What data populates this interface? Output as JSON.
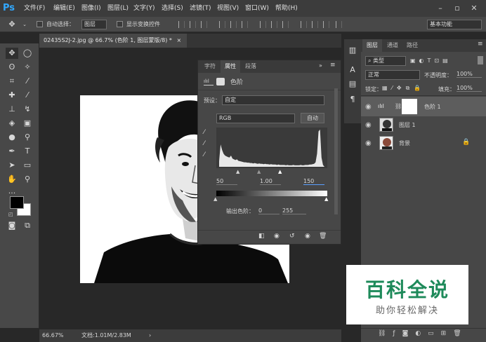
{
  "app": {
    "logo": "Ps",
    "menu": [
      "文件(F)",
      "编辑(E)",
      "图像(I)",
      "图层(L)",
      "文字(Y)",
      "选择(S)",
      "滤镜(T)",
      "视图(V)",
      "窗口(W)",
      "帮助(H)"
    ]
  },
  "options": {
    "auto_select": "自动选择：",
    "layer_select": "图层",
    "show_transform": "显示变换控件",
    "workspace": "基本功能"
  },
  "document": {
    "tab_title": "02435S2J-2.jpg @ 66.7% (色阶 1, 图层蒙版/8) *",
    "close": "×"
  },
  "status": {
    "zoom": "66.67%",
    "doc_size": "文档:1.01M/2.83M"
  },
  "properties": {
    "tabs": [
      "字符",
      "属性",
      "段落"
    ],
    "adjustment_name": "色阶",
    "preset_label": "预设：",
    "preset_value": "自定",
    "channel": "RGB",
    "auto_button": "自动",
    "input_levels": {
      "black": "50",
      "gamma": "1.00",
      "white": "150"
    },
    "output_label": "输出色阶：",
    "output_black": "0",
    "output_white": "255"
  },
  "layers_panel": {
    "tabs": [
      "图层",
      "通道",
      "路径"
    ],
    "kind_filter": "类型",
    "blend_mode": "正常",
    "opacity_label": "不透明度：",
    "opacity": "100%",
    "lock_label": "锁定：",
    "fill_label": "填充：",
    "fill": "100%",
    "layers": [
      {
        "name": "色阶 1",
        "type": "adjustment"
      },
      {
        "name": "图层 1",
        "type": "pixel"
      },
      {
        "name": "背景",
        "type": "background"
      }
    ]
  },
  "watermark": {
    "title": "百科全说",
    "subtitle": "助你轻松解决"
  },
  "histogram": [
    0.15,
    0.6,
    0.45,
    0.35,
    0.3,
    0.28,
    0.26,
    0.25,
    0.3,
    0.22,
    0.2,
    0.18,
    0.2,
    0.16,
    0.15,
    0.14,
    0.13,
    0.12,
    0.12,
    0.11,
    0.11,
    0.1,
    0.1,
    0.09,
    0.1,
    0.09,
    0.08,
    0.09,
    0.08,
    0.08,
    0.07,
    0.08,
    0.07,
    0.07,
    0.06,
    0.07,
    0.06,
    0.06,
    0.06,
    0.05,
    0.06,
    0.05,
    0.05,
    0.05,
    0.05,
    0.04,
    0.05,
    0.04,
    0.04,
    0.04,
    0.05,
    0.04,
    0.04,
    0.04,
    0.04,
    0.05,
    0.04,
    0.04,
    0.05,
    0.05,
    0.05,
    0.06,
    0.06,
    0.07,
    0.08,
    0.12,
    0.35,
    0.95,
    1.0,
    0.25,
    0.05
  ],
  "colors": {
    "accent": "#31a8ff",
    "panel": "#474747",
    "dark": "#282828"
  }
}
